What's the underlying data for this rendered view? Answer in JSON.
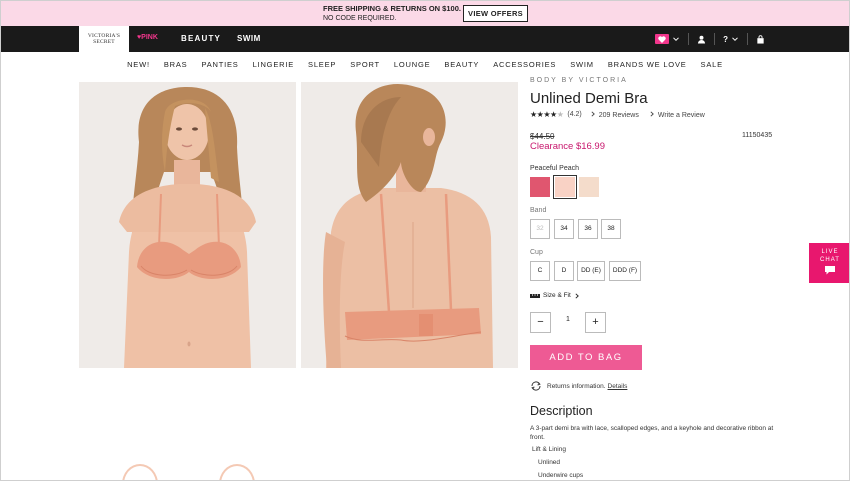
{
  "promo": {
    "line1": "FREE SHIPPING & RETURNS ON $100.",
    "line2": "NO CODE REQUIRED.",
    "button": "VIEW OFFERS"
  },
  "header": {
    "logo": "VICTORIA'S SECRET",
    "brands": [
      "♥PINK",
      "BEAUTY",
      "SWIM"
    ],
    "icons": [
      "heart-icon",
      "account-icon",
      "help-icon",
      "bag-icon"
    ],
    "help_label": "?"
  },
  "nav": [
    "NEW!",
    "BRAS",
    "PANTIES",
    "LINGERIE",
    "SLEEP",
    "SPORT",
    "LOUNGE",
    "BEAUTY",
    "ACCESSORIES",
    "SWIM",
    "BRANDS WE LOVE",
    "SALE"
  ],
  "product": {
    "byline": "BODY BY VICTORIA",
    "title": "Unlined Demi Bra",
    "rating": 4.2,
    "rating_text": "(4.2)",
    "reviews": "209 Reviews",
    "write_review": "Write a Review",
    "original_price": "$44.50",
    "clearance_price": "Clearance $16.99",
    "sku": "11150435",
    "color_name": "Peaceful Peach",
    "colors": [
      "#e0566f",
      "#f9d2c5",
      "#f4dccb"
    ],
    "selected_color": 1,
    "band_label": "Band",
    "bands": [
      "32",
      "34",
      "36",
      "38"
    ],
    "cup_label": "Cup",
    "cups": [
      "C",
      "D",
      "DD (E)",
      "DDD (F)"
    ],
    "size_fit": "Size & Fit",
    "quantity": "1",
    "add_to_bag": "ADD TO BAG",
    "returns": "Returns information.",
    "returns_link": "Details",
    "description_title": "Description",
    "description": "A 3-part demi bra with lace, scalloped edges, and a keyhole and decorative ribbon at front.",
    "lift_title": "Lift & Lining",
    "bullets": [
      "Unlined",
      "Underwire cups"
    ]
  },
  "live_chat": {
    "line1": "LIVE",
    "line2": "CHAT"
  },
  "colors": {
    "promo_bg": "#fbd9e7",
    "header_bg": "#1a1a1a",
    "accent_pink": "#ee5a94",
    "clearance": "#c8176d",
    "chat_bg": "#e8176e"
  }
}
